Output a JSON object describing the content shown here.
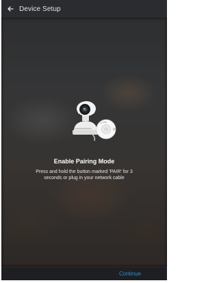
{
  "header": {
    "title": "Device Setup",
    "back_icon": "arrow-left-icon"
  },
  "main": {
    "illustration_icon": "camera-and-pairing-hub-illustration",
    "heading": "Enable Pairing Mode",
    "description": "Press and hold the button marked 'PAIR' for 3 seconds or plug in your network cable"
  },
  "footer": {
    "continue_label": "Continue"
  },
  "colors": {
    "appbar": "#2a2c2f",
    "accent": "#2f8fd6",
    "footer": "#1d1f22"
  }
}
